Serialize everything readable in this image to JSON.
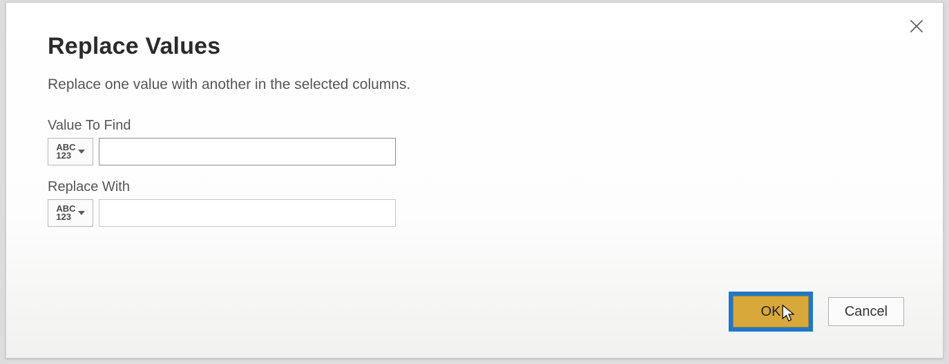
{
  "dialog": {
    "title": "Replace Values",
    "subtitle": "Replace one value with another in the selected columns.",
    "fields": {
      "find": {
        "label": "Value To Find",
        "type_abc": "ABC",
        "type_123": "123",
        "value": ""
      },
      "replace": {
        "label": "Replace With",
        "type_abc": "ABC",
        "type_123": "123",
        "value": ""
      }
    },
    "buttons": {
      "ok": "OK",
      "cancel": "Cancel"
    }
  }
}
